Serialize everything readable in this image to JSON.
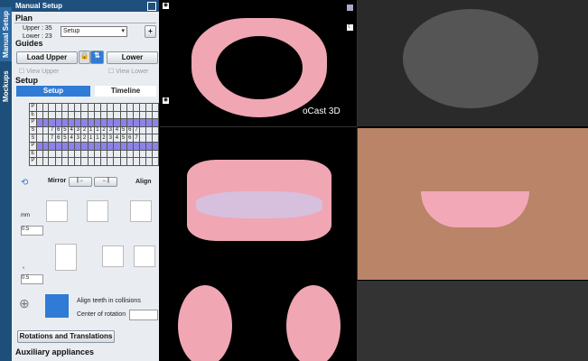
{
  "tabs": {
    "manual_setup": "Manual Setup",
    "mockups": "Mockups"
  },
  "panel": {
    "title": "Manual Setup",
    "plan": {
      "heading": "Plan",
      "upper": "Upper : 35",
      "lower": "Lower : 23",
      "select_value": "Setup",
      "add_label": "+"
    },
    "guides": {
      "heading": "Guides",
      "load_upper": "Load Upper",
      "lower": "Lower",
      "view_upper": "View Upper",
      "view_lower": "View Lower"
    },
    "setup": {
      "heading": "Setup",
      "tab_setup": "Setup",
      "tab_timeline": "Timeline",
      "row_labels": [
        "P",
        "E",
        "P",
        "S",
        "S",
        "P",
        "E",
        "P"
      ],
      "numbers": [
        "7",
        "6",
        "5",
        "4",
        "3",
        "2",
        "1",
        "1",
        "2",
        "3",
        "4",
        "5",
        "6",
        "7"
      ]
    },
    "mirror_label": "Mirror",
    "align_label": "Align",
    "unit_mm": "mm",
    "step_mm": "0.5",
    "unit_deg": "°",
    "step_deg": "0.5",
    "align_collisions": "Align teeth in collisions",
    "center_rotation": "Center of rotation",
    "rotations_button": "Rotations and Translations",
    "auxiliary_heading": "Auxiliary appliances"
  },
  "viewer": {
    "brand_text": "oCast 3D"
  },
  "colors": {
    "panel_header": "#1f4f7d",
    "grid_highlight": "#8c83e8",
    "gum": "#f0a6b3"
  }
}
